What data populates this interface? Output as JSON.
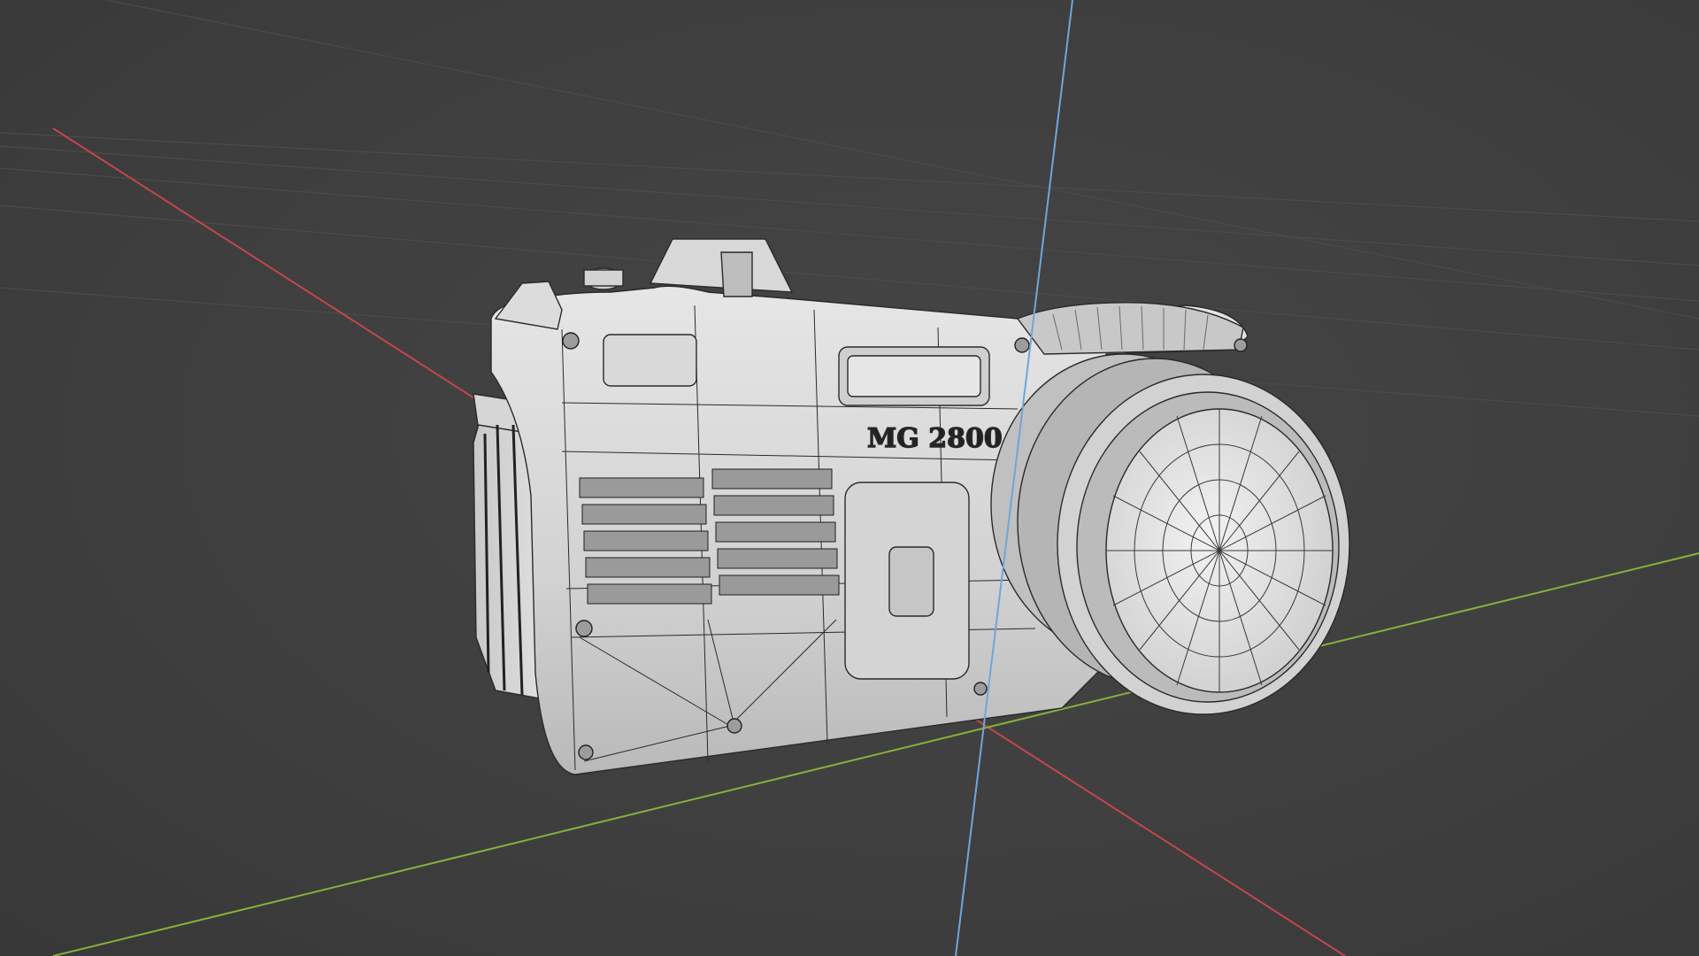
{
  "viewport": {
    "background": "#3d3d3d",
    "grid_color": "#4a4a4a",
    "axes": {
      "x_color": "#c4454d",
      "y_color": "#86b13a",
      "z_color": "#6fa6d8"
    }
  },
  "model": {
    "name": "camera",
    "body_color": "#cfcfcf",
    "wire_color": "#2a2a2a",
    "label_text": "MG 2800",
    "lens_ring_text": "",
    "lens_color": "#e3e3e3"
  }
}
